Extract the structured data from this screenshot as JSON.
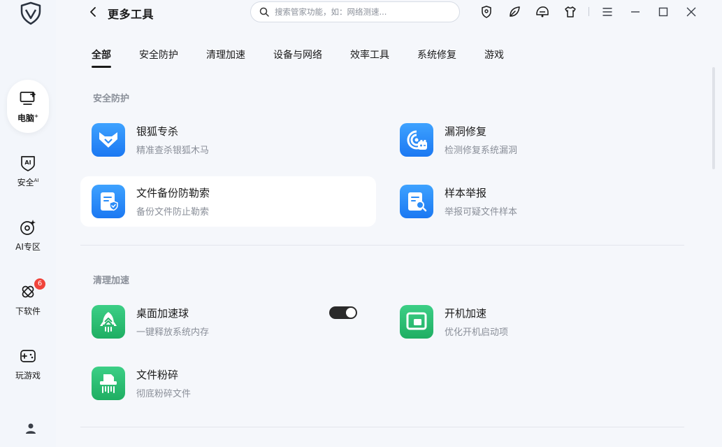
{
  "app": {
    "title": "更多工具"
  },
  "search": {
    "placeholder": "搜索管家功能，如：网络测速..."
  },
  "sidebar": {
    "items": [
      {
        "label": "电脑",
        "sup": "+"
      },
      {
        "label": "安全",
        "sup": "AI"
      },
      {
        "label": "AI专区"
      },
      {
        "label": "下软件",
        "badge": "6"
      },
      {
        "label": "玩游戏"
      }
    ]
  },
  "tabs": [
    {
      "label": "全部"
    },
    {
      "label": "安全防护"
    },
    {
      "label": "清理加速"
    },
    {
      "label": "设备与网络"
    },
    {
      "label": "效率工具"
    },
    {
      "label": "系统修复"
    },
    {
      "label": "游戏"
    }
  ],
  "sections": [
    {
      "title": "安全防护",
      "tools": [
        {
          "name": "银狐专杀",
          "desc": "精准查杀银狐木马"
        },
        {
          "name": "漏洞修复",
          "desc": "检测修复系统漏洞"
        },
        {
          "name": "文件备份防勒索",
          "desc": "备份文件防止勒索"
        },
        {
          "name": "样本举报",
          "desc": "举报可疑文件样本"
        }
      ]
    },
    {
      "title": "清理加速",
      "tools": [
        {
          "name": "桌面加速球",
          "desc": "一键释放系统内存",
          "toggle": "on"
        },
        {
          "name": "开机加速",
          "desc": "优化开机启动项"
        },
        {
          "name": "文件粉碎",
          "desc": "彻底粉碎文件"
        }
      ]
    }
  ],
  "colors": {
    "accent_blue": "#1b78f2",
    "accent_green": "#1fae62",
    "badge_red": "#f0443b"
  }
}
